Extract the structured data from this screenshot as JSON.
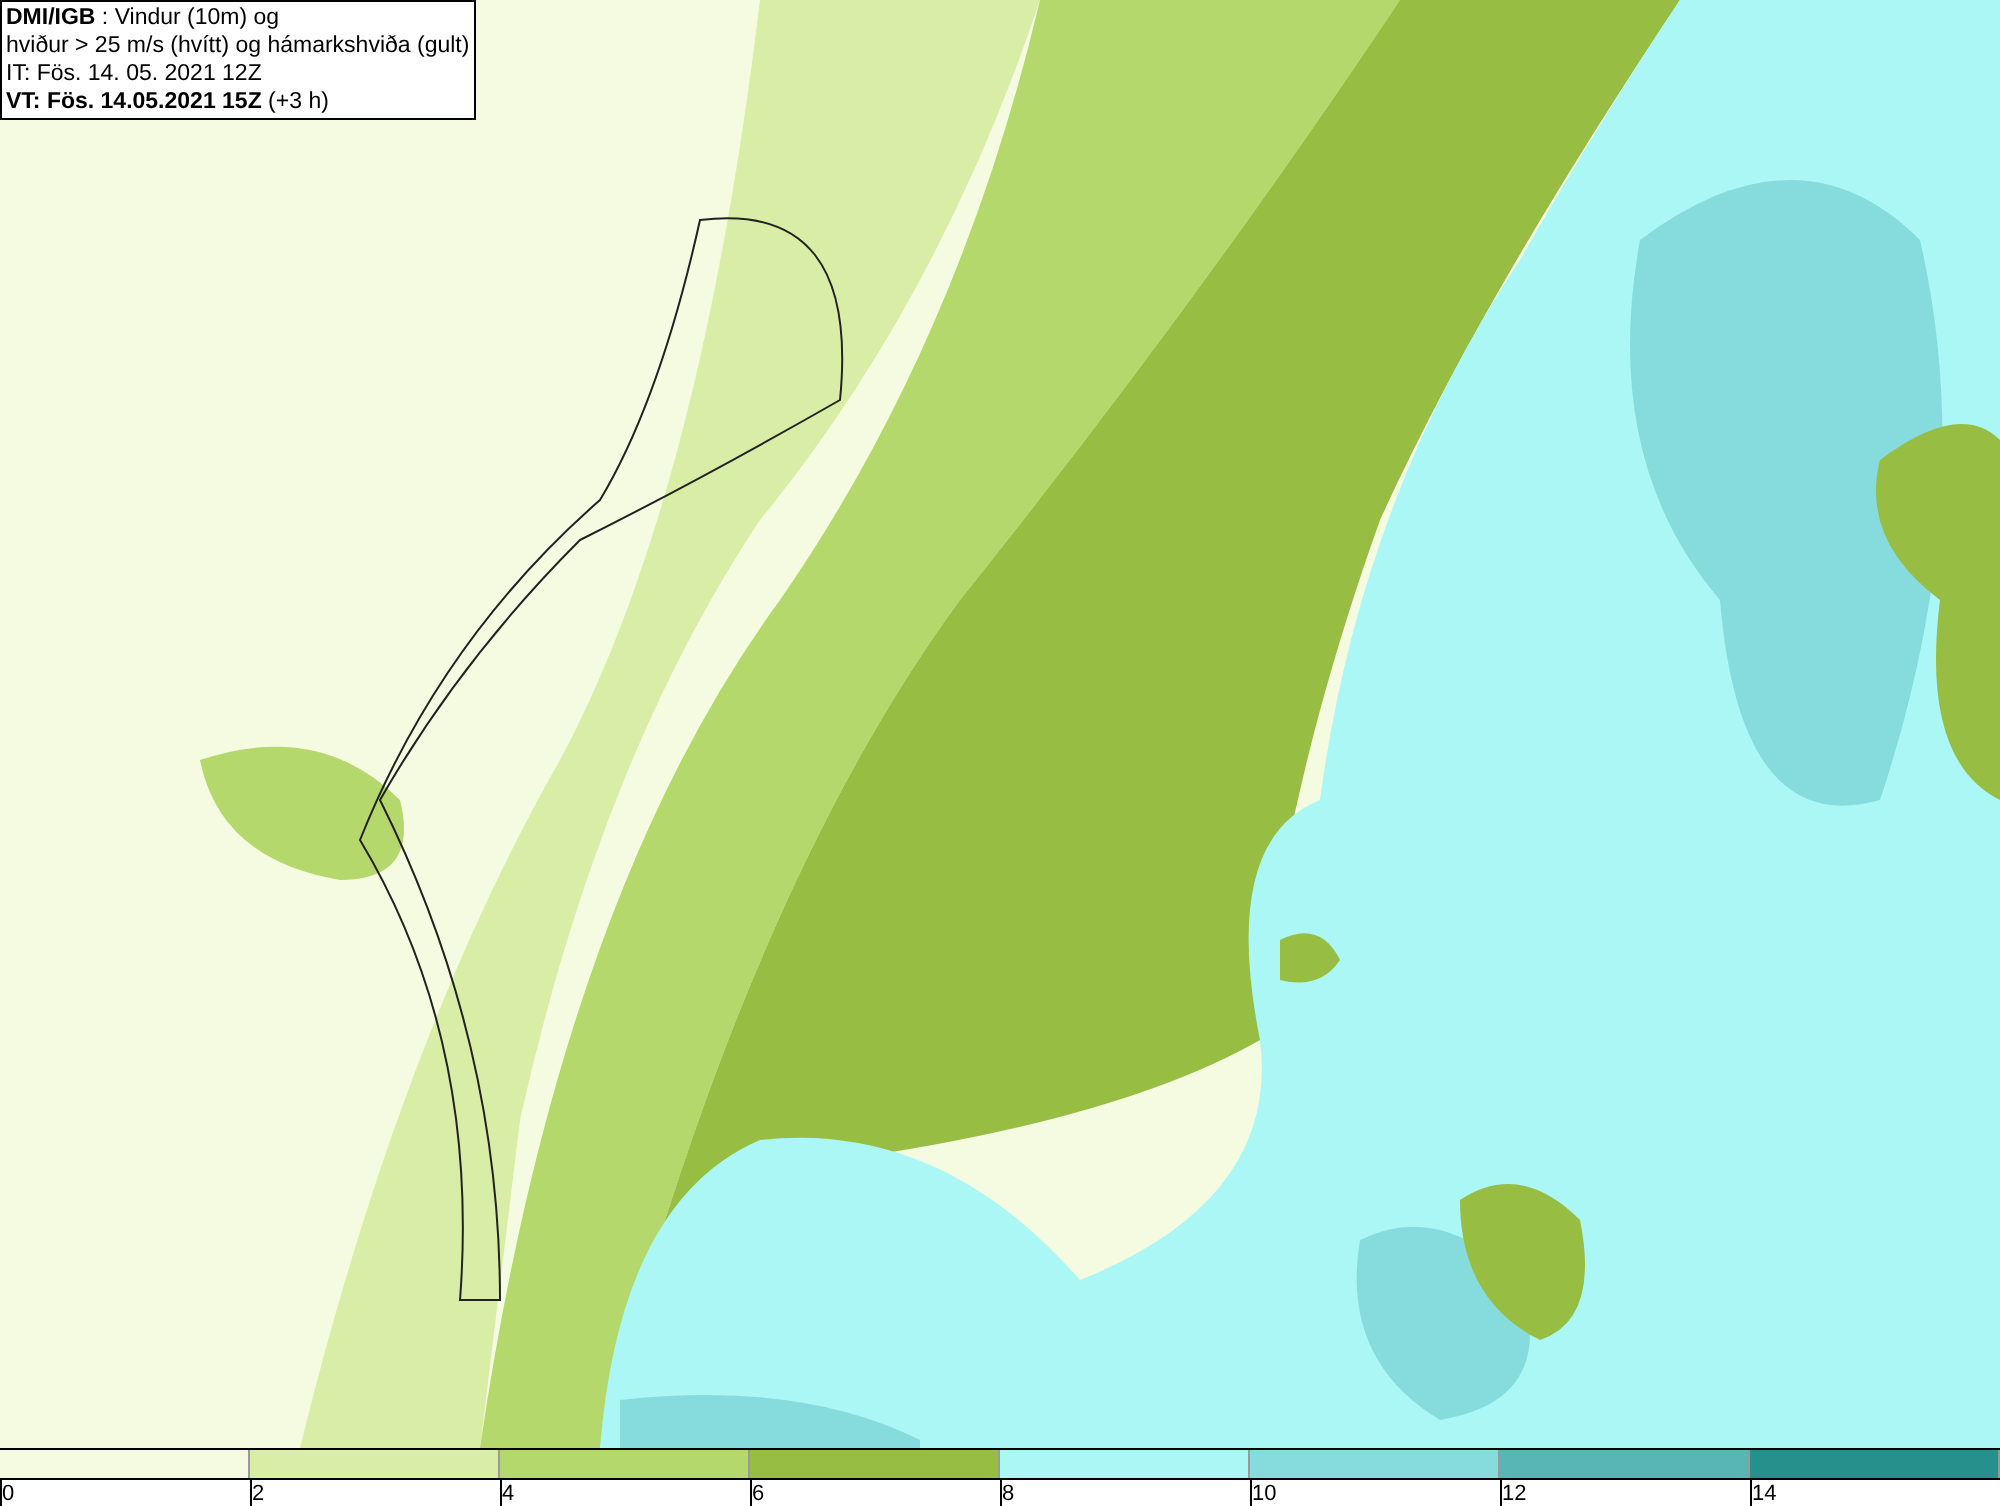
{
  "info_box": {
    "lines": [
      "**DMI/IGB** : Vindur (10m) og",
      "hviður > 25 m/s (hvítt) og hámarkshviða (gult)",
      "IT: Fös. 14. 05. 2021 12Z",
      "**VT: Fös. 14.05.2021 15Z** (+3 h)"
    ]
  },
  "legend": {
    "bins": [
      {
        "label": "0",
        "color": "#f5fbe0"
      },
      {
        "label": "2",
        "color": "#d8eea6"
      },
      {
        "label": "4",
        "color": "#b5d86c"
      },
      {
        "label": "6",
        "color": "#97bd42"
      },
      {
        "label": "8",
        "color": "#aaf7f5"
      },
      {
        "label": "10",
        "color": "#86dcdc"
      },
      {
        "label": "12",
        "color": "#58b6b4"
      },
      {
        "label": "14",
        "color": "#25908c"
      }
    ]
  }
}
